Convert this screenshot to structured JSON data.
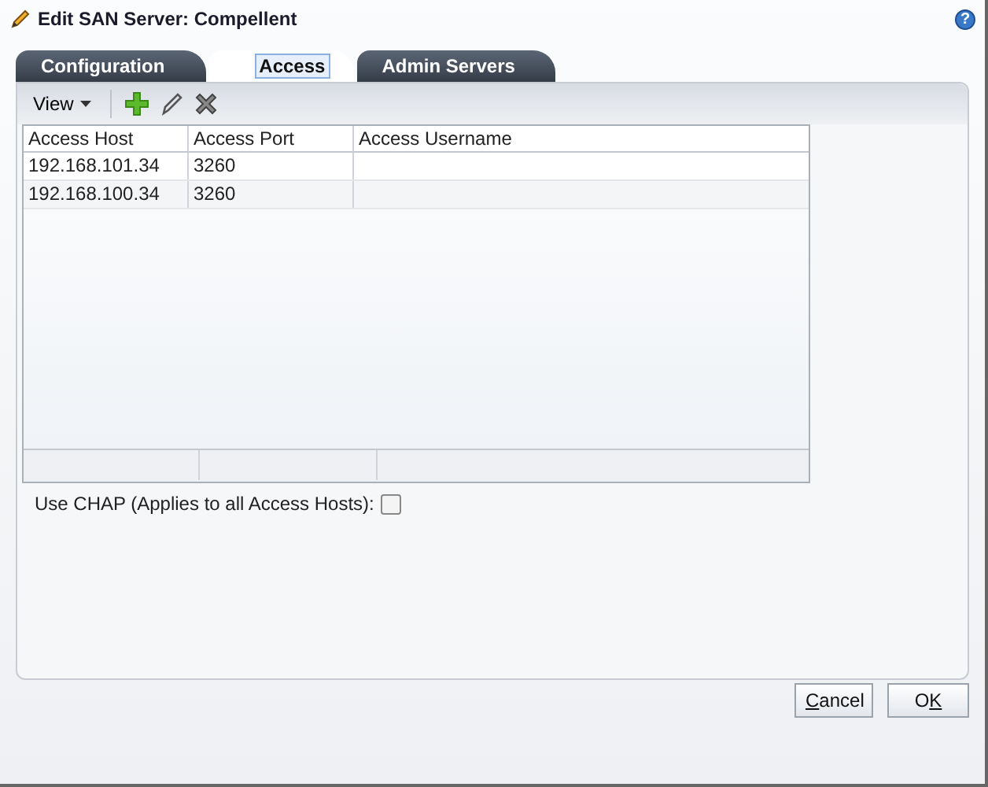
{
  "window": {
    "title": "Edit SAN Server: Compellent",
    "help": "?"
  },
  "tabs": [
    {
      "label": "Configuration",
      "selected": false
    },
    {
      "label": "Access",
      "selected": true
    },
    {
      "label": "Admin Servers",
      "selected": false
    }
  ],
  "toolbar": {
    "view_menu": "View"
  },
  "table": {
    "columns": [
      "Access Host",
      "Access Port",
      "Access Username"
    ],
    "rows": [
      [
        "192.168.101.34",
        "3260",
        ""
      ],
      [
        "192.168.100.34",
        "3260",
        ""
      ]
    ]
  },
  "chap": {
    "label": "Use CHAP (Applies to all Access Hosts):",
    "checked": false
  },
  "buttons": [
    {
      "key": "C",
      "after": "ancel"
    },
    {
      "before": "O",
      "key": "K"
    }
  ]
}
